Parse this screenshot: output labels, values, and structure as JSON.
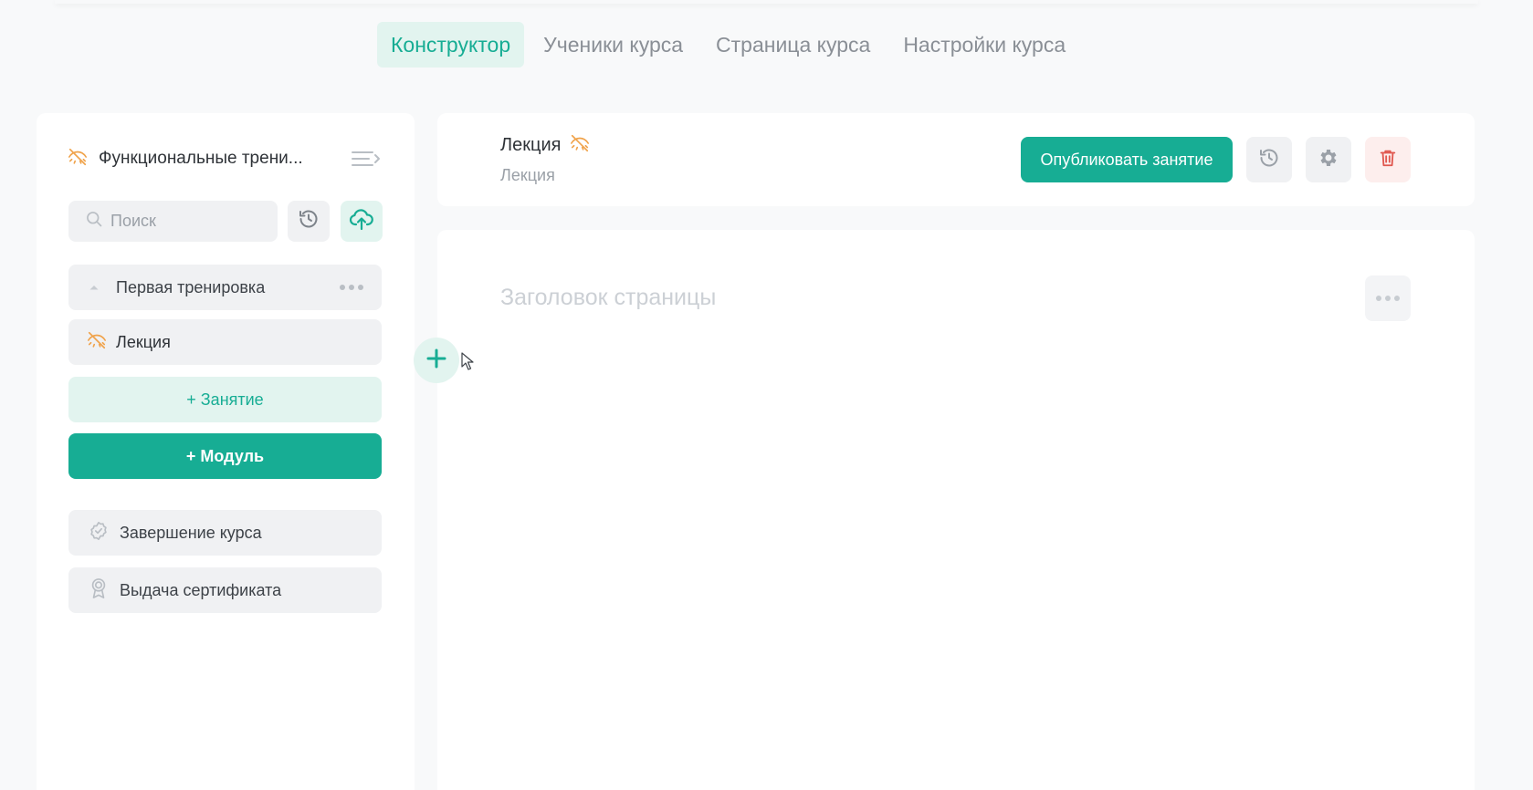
{
  "tabs": [
    {
      "label": "Конструктор",
      "active": true
    },
    {
      "label": "Ученики курса",
      "active": false
    },
    {
      "label": "Страница курса",
      "active": false
    },
    {
      "label": "Настройки курса",
      "active": false
    }
  ],
  "sidebar": {
    "course_title": "Функциональные трени...",
    "search_placeholder": "Поиск",
    "module": {
      "label": "Первая тренировка"
    },
    "lesson": {
      "label": "Лекция"
    },
    "add_lesson_label": "+ Занятие",
    "add_module_label": "+ Модуль",
    "finish_label": "Завершение курса",
    "certificate_label": "Выдача сертификата"
  },
  "lesson_header": {
    "title": "Лекция",
    "type": "Лекция",
    "publish_label": "Опубликовать занятие"
  },
  "content": {
    "heading_placeholder": "Заголовок страницы"
  },
  "icons": {
    "hidden": "eye-off-icon",
    "collapse": "collapse-sidebar-icon",
    "search": "search-icon",
    "history": "history-icon",
    "upload": "cloud-upload-icon",
    "settings": "gear-icon",
    "delete": "trash-icon",
    "finish": "badge-check-icon",
    "certificate": "award-icon",
    "add": "plus-icon"
  },
  "colors": {
    "accent": "#17ad94",
    "accent_light": "#e2f4ef",
    "warning": "#f0a34b",
    "danger": "#e0574f",
    "danger_light": "#fdeeed"
  }
}
